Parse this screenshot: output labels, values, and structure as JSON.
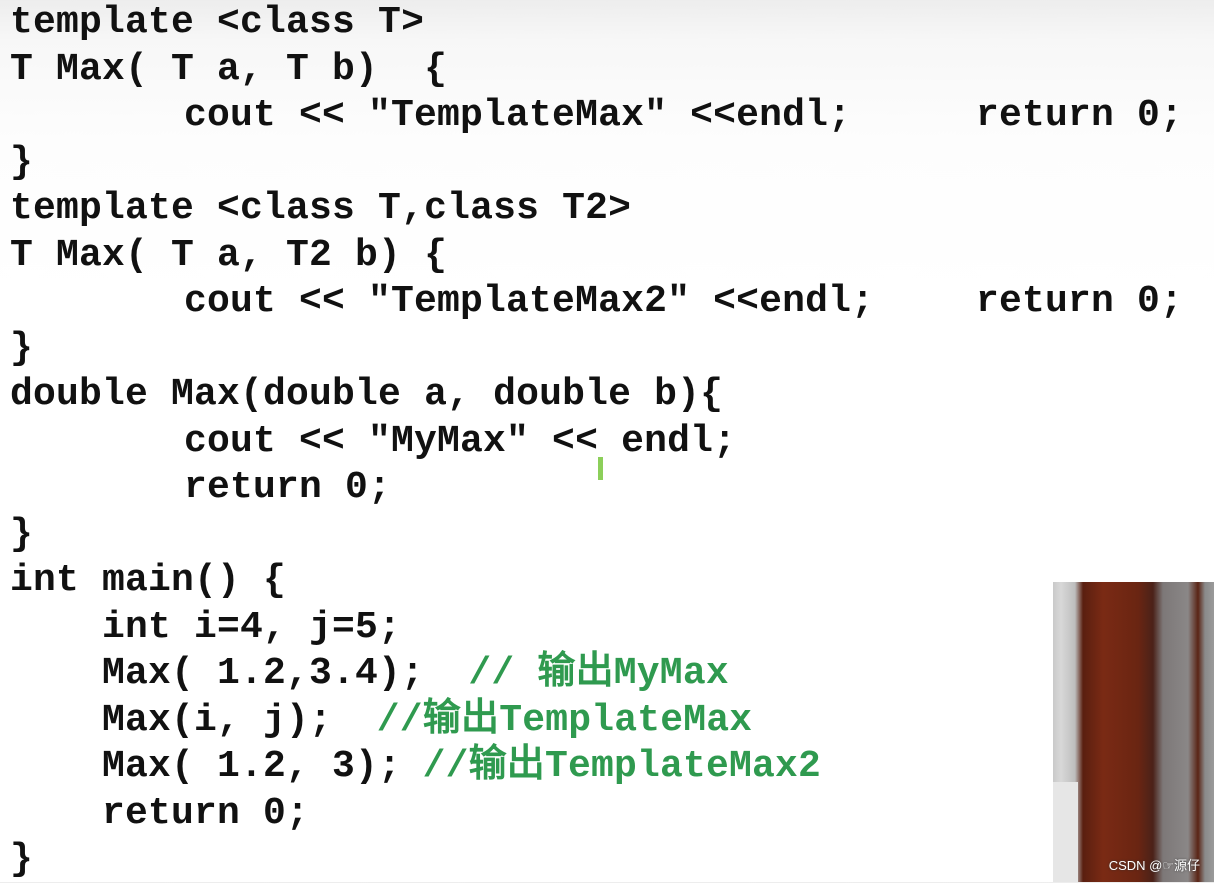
{
  "code_lines": [
    {
      "segments": [
        {
          "text": "template <class T>",
          "col": "c0"
        }
      ]
    },
    {
      "segments": [
        {
          "text": "T Max( T a, T b)  {",
          "col": "c0"
        }
      ]
    },
    {
      "segments": [
        {
          "text": "cout << \"TemplateMax\" <<endl;",
          "col": "c1"
        },
        {
          "text": "return 0;",
          "col": "cr"
        }
      ]
    },
    {
      "segments": [
        {
          "text": "}",
          "col": "c0"
        }
      ]
    },
    {
      "segments": [
        {
          "text": "template <class T,class T2>",
          "col": "c0"
        }
      ]
    },
    {
      "segments": [
        {
          "text": "T Max( T a, T2 b) {",
          "col": "c0"
        }
      ]
    },
    {
      "segments": [
        {
          "text": "cout << \"TemplateMax2\" <<endl;",
          "col": "c1"
        },
        {
          "text": "return 0;",
          "col": "cr"
        }
      ]
    },
    {
      "segments": [
        {
          "text": "}",
          "col": "c0"
        }
      ]
    },
    {
      "segments": [
        {
          "text": "double Max(double a, double b){",
          "col": "c0"
        }
      ]
    },
    {
      "segments": [
        {
          "text": "cout << \"MyMax\" << endl;",
          "col": "c1"
        }
      ]
    },
    {
      "segments": [
        {
          "text": "return 0;",
          "col": "c1"
        }
      ]
    },
    {
      "segments": [
        {
          "text": "}",
          "col": "c0"
        }
      ]
    },
    {
      "segments": [
        {
          "text": "int main() {",
          "col": "c0"
        }
      ]
    },
    {
      "segments": [
        {
          "text": "int i=4, j=5;",
          "col": "c2"
        }
      ]
    },
    {
      "segments": [
        {
          "text": "Max( 1.2,3.4);  ",
          "col": "c2"
        },
        {
          "text": "// 输出MyMax",
          "col": "c2",
          "comment": true,
          "offset": 16
        }
      ]
    },
    {
      "segments": [
        {
          "text": "Max(i, j);  ",
          "col": "c2"
        },
        {
          "text": "//输出TemplateMax",
          "col": "c2",
          "comment": true,
          "offset": 12
        }
      ]
    },
    {
      "segments": [
        {
          "text": "Max( 1.2, 3); ",
          "col": "c2"
        },
        {
          "text": "//输出TemplateMax2",
          "col": "c2",
          "comment": true,
          "offset": 14
        }
      ]
    },
    {
      "segments": [
        {
          "text": "return 0;",
          "col": "c2"
        }
      ]
    },
    {
      "segments": [
        {
          "text": "}",
          "col": "c0"
        }
      ]
    }
  ],
  "colors": {
    "code": "#111111",
    "comment": "#2f9a4f",
    "cursor": "#8ccf5a"
  },
  "video": {
    "watermark": "CSDN @☞源仔"
  }
}
